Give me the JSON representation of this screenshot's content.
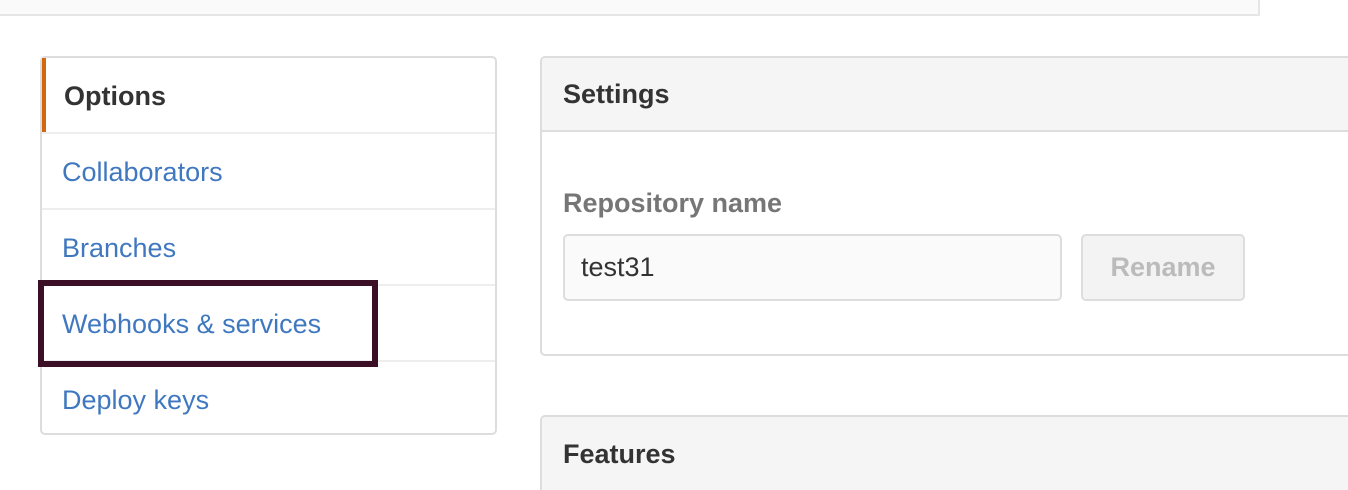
{
  "sidebar": {
    "items": [
      {
        "label": "Options"
      },
      {
        "label": "Collaborators"
      },
      {
        "label": "Branches"
      },
      {
        "label": "Webhooks & services"
      },
      {
        "label": "Deploy keys"
      }
    ],
    "selected_index": 0,
    "highlighted_item": "Webhooks & services"
  },
  "settings": {
    "title": "Settings",
    "repository_name_label": "Repository name",
    "repository_name_value": "test31",
    "rename_label": "Rename"
  },
  "features": {
    "title": "Features"
  },
  "colors": {
    "link": "#4078c0",
    "selected_accent": "#d26911",
    "highlight_box": "#3b0f26"
  }
}
